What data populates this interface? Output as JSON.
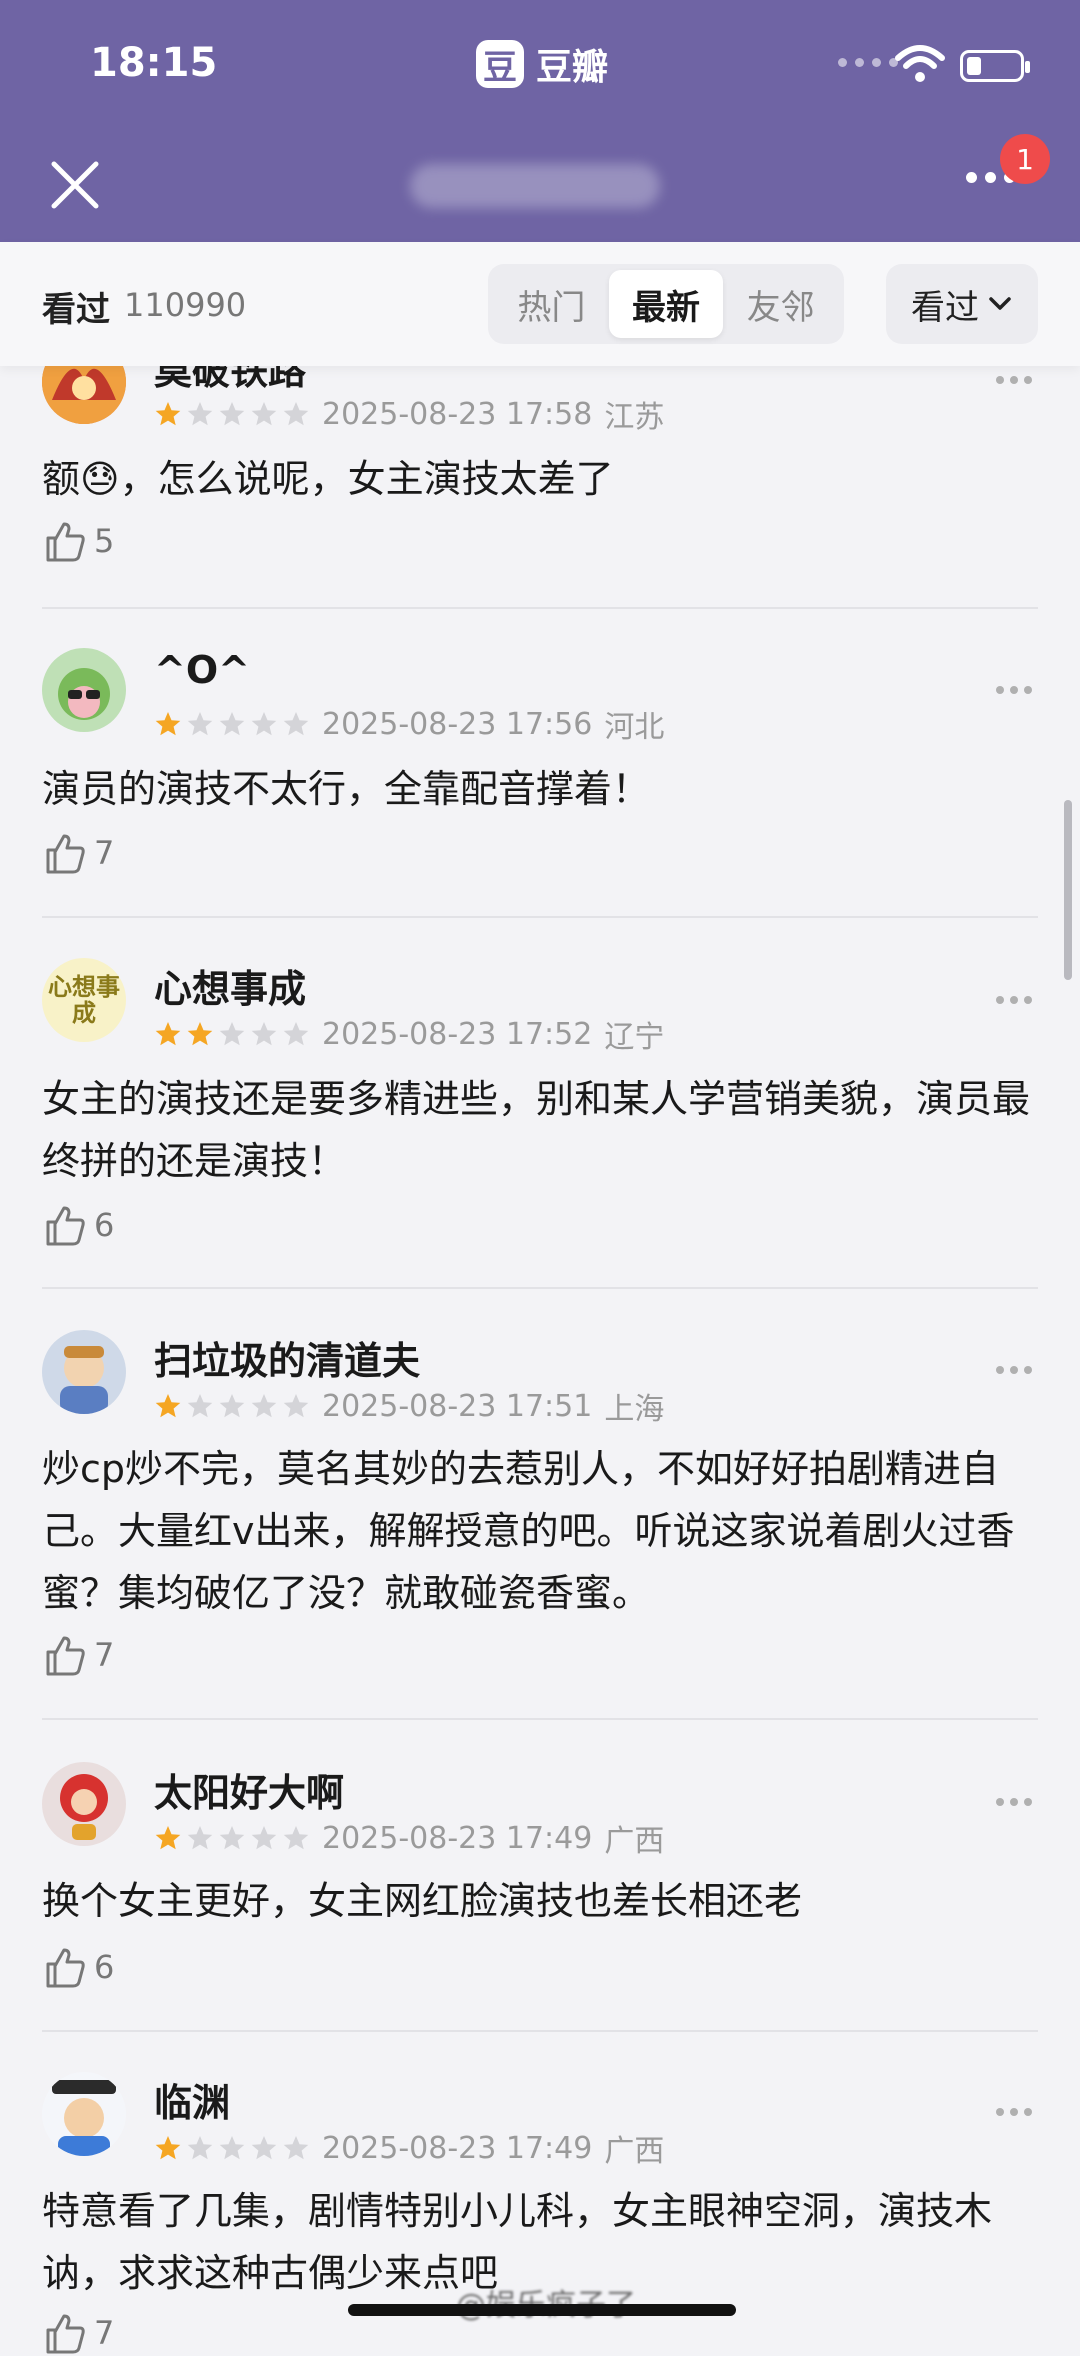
{
  "status_bar": {
    "time": "18:15"
  },
  "app": {
    "icon_glyph": "豆",
    "name": "豆瓣"
  },
  "header": {
    "notification_count": "1",
    "brand_color": "#6f64a4"
  },
  "filter_bar": {
    "seen_label": "看过",
    "seen_count": "110990",
    "tabs": [
      {
        "label": "热门",
        "active": false
      },
      {
        "label": "最新",
        "active": true
      },
      {
        "label": "友邻",
        "active": false
      }
    ],
    "select_label": "看过"
  },
  "reviews": [
    {
      "user": "莫破铁路",
      "rating": 1,
      "time": "2025-08-23 17:58",
      "region": "江苏",
      "text_before": "额",
      "emoji": "😓",
      "text_after": "，怎么说呢，女主演技太差了",
      "likes": "5"
    },
    {
      "user": "^O^",
      "rating": 1,
      "time": "2025-08-23 17:56",
      "region": "河北",
      "text": "演员的演技不太行，全靠配音撑着！",
      "likes": "7"
    },
    {
      "user": "心想事成",
      "rating": 2,
      "time": "2025-08-23 17:52",
      "region": "辽宁",
      "text": "女主的演技还是要多精进些，别和某人学营销美貌，演员最终拼的还是演技！",
      "likes": "6",
      "avatar_text": "心想事成"
    },
    {
      "user": "扫垃圾的清道夫",
      "rating": 1,
      "time": "2025-08-23 17:51",
      "region": "上海",
      "text": "炒cp炒不完，莫名其妙的去惹别人，不如好好拍剧精进自己。大量红v出来，解解授意的吧。听说这家说着剧火过香蜜？集均破亿了没？就敢碰瓷香蜜。",
      "likes": "7"
    },
    {
      "user": "太阳好大啊",
      "rating": 1,
      "time": "2025-08-23 17:49",
      "region": "广西",
      "text": "换个女主更好，女主网红脸演技也差长相还老",
      "likes": "6"
    },
    {
      "user": "临渊",
      "rating": 1,
      "time": "2025-08-23 17:49",
      "region": "广西",
      "text": "特意看了几集，剧情特别小儿科，女主眼神空洞，演技木讷，求求这种古偶少来点吧",
      "likes": "7"
    }
  ],
  "watermark": "@娱乐疯子了"
}
